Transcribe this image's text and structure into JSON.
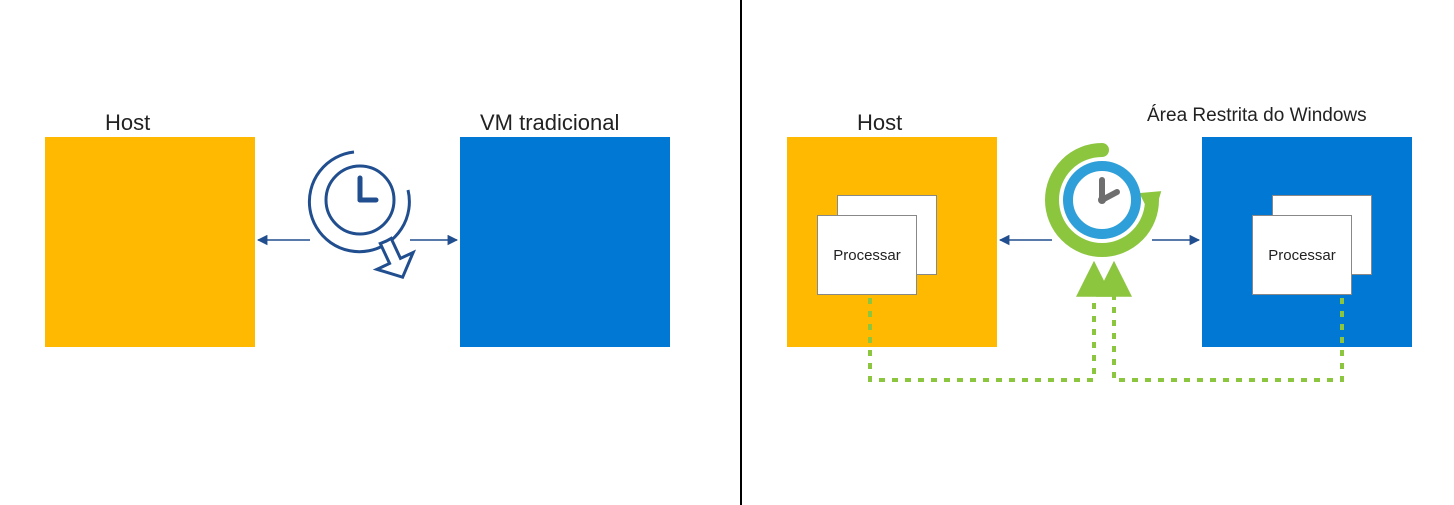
{
  "left": {
    "host_label": "Host",
    "vm_label": "VM tradicional"
  },
  "right": {
    "host_label": "Host",
    "sandbox_label": "Área Restrita do Windows",
    "process_label": "Processar"
  },
  "colors": {
    "host_box": "#FFB900",
    "vm_box": "#0078D4",
    "outline_blue": "#214E8F",
    "scheduler_blue": "#2E9FD8",
    "scheduler_green": "#8CC63F",
    "dotted_green": "#8CC63F",
    "clock_gray": "#6E6E6E"
  }
}
